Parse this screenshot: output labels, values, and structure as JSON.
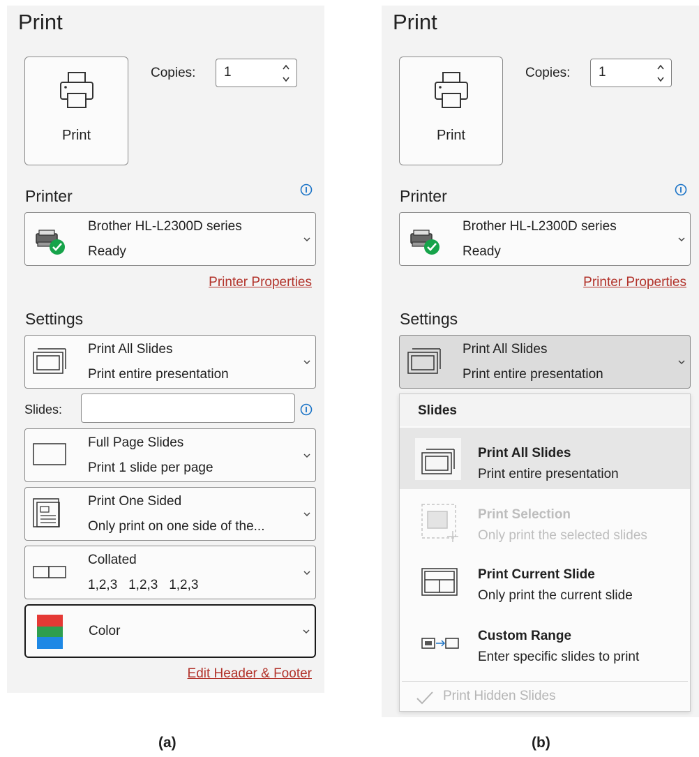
{
  "panel_a": {
    "title": "Print",
    "print_button_label": "Print",
    "copies_label": "Copies:",
    "copies_value": "1",
    "printer_section": "Printer",
    "printer_name": "Brother HL-L2300D series",
    "printer_status": "Ready",
    "printer_properties_link": "Printer Properties",
    "settings_section": "Settings",
    "settings": {
      "slides_range": {
        "title": "Print All Slides",
        "subtitle": "Print entire presentation"
      },
      "slides_label": "Slides:",
      "slides_input_value": "",
      "layout": {
        "title": "Full Page Slides",
        "subtitle": "Print 1 slide per page"
      },
      "sides": {
        "title": "Print One Sided",
        "subtitle": "Only print on one side of the..."
      },
      "collation": {
        "title": "Collated",
        "subtitle": "1,2,3   1,2,3   1,2,3"
      },
      "color": {
        "title": "Color"
      }
    },
    "edit_header_footer_link": "Edit Header & Footer"
  },
  "panel_b": {
    "title": "Print",
    "print_button_label": "Print",
    "copies_label": "Copies:",
    "copies_value": "1",
    "printer_section": "Printer",
    "printer_name": "Brother HL-L2300D series",
    "printer_status": "Ready",
    "printer_properties_link": "Printer Properties",
    "settings_section": "Settings",
    "slides_dropdown": {
      "title": "Print All Slides",
      "subtitle": "Print entire presentation"
    },
    "menu": {
      "header": "Slides",
      "items": [
        {
          "title": "Print All Slides",
          "subtitle": "Print entire presentation",
          "state": "selected"
        },
        {
          "title": "Print Selection",
          "subtitle": "Only print the selected slides",
          "state": "disabled"
        },
        {
          "title": "Print Current Slide",
          "subtitle": "Only print the current slide",
          "state": "enabled"
        },
        {
          "title": "Custom Range",
          "subtitle": "Enter specific slides to print",
          "state": "enabled"
        }
      ],
      "hidden_slides_label": "Print Hidden Slides",
      "hidden_slides_checked": true
    }
  },
  "captions": {
    "a": "(a)",
    "b": "(b)"
  },
  "colors": {
    "panel_bg": "#f3f3f3",
    "link": "#b2322a",
    "info_icon": "#1a73c7",
    "status_ok": "#16a34a",
    "swatch_red": "#e53935",
    "swatch_green": "#2e9e4f",
    "swatch_blue": "#1e88e5",
    "selected_bg": "#e6e6e6"
  },
  "icons": [
    "printer-icon",
    "info-icon",
    "printer-ready-icon",
    "chevron-down-icon",
    "all-slides-icon",
    "full-page-icon",
    "one-sided-icon",
    "collated-icon",
    "color-swatch-icon",
    "selection-icon",
    "current-slide-icon",
    "custom-range-icon",
    "checkmark-icon"
  ]
}
